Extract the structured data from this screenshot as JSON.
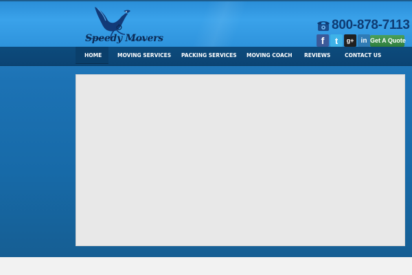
{
  "header": {
    "logo_text": "Speedy Movers",
    "phone": "800-878-7113",
    "quote_button": "Get A Quote",
    "social": {
      "facebook": "f",
      "twitter": "t",
      "googleplus": "g+",
      "linkedin": "in"
    }
  },
  "nav": {
    "items": [
      {
        "label": "HOME"
      },
      {
        "label": "MOVING SERVICES"
      },
      {
        "label": "PACKING SERVICES"
      },
      {
        "label": "MOVING COACH"
      },
      {
        "label": "REVIEWS"
      },
      {
        "label": "CONTACT US"
      }
    ]
  },
  "colors": {
    "brand_blue": "#2f88cc",
    "nav_dark": "#0d4b7c",
    "quote_green": "#3a8f49"
  }
}
